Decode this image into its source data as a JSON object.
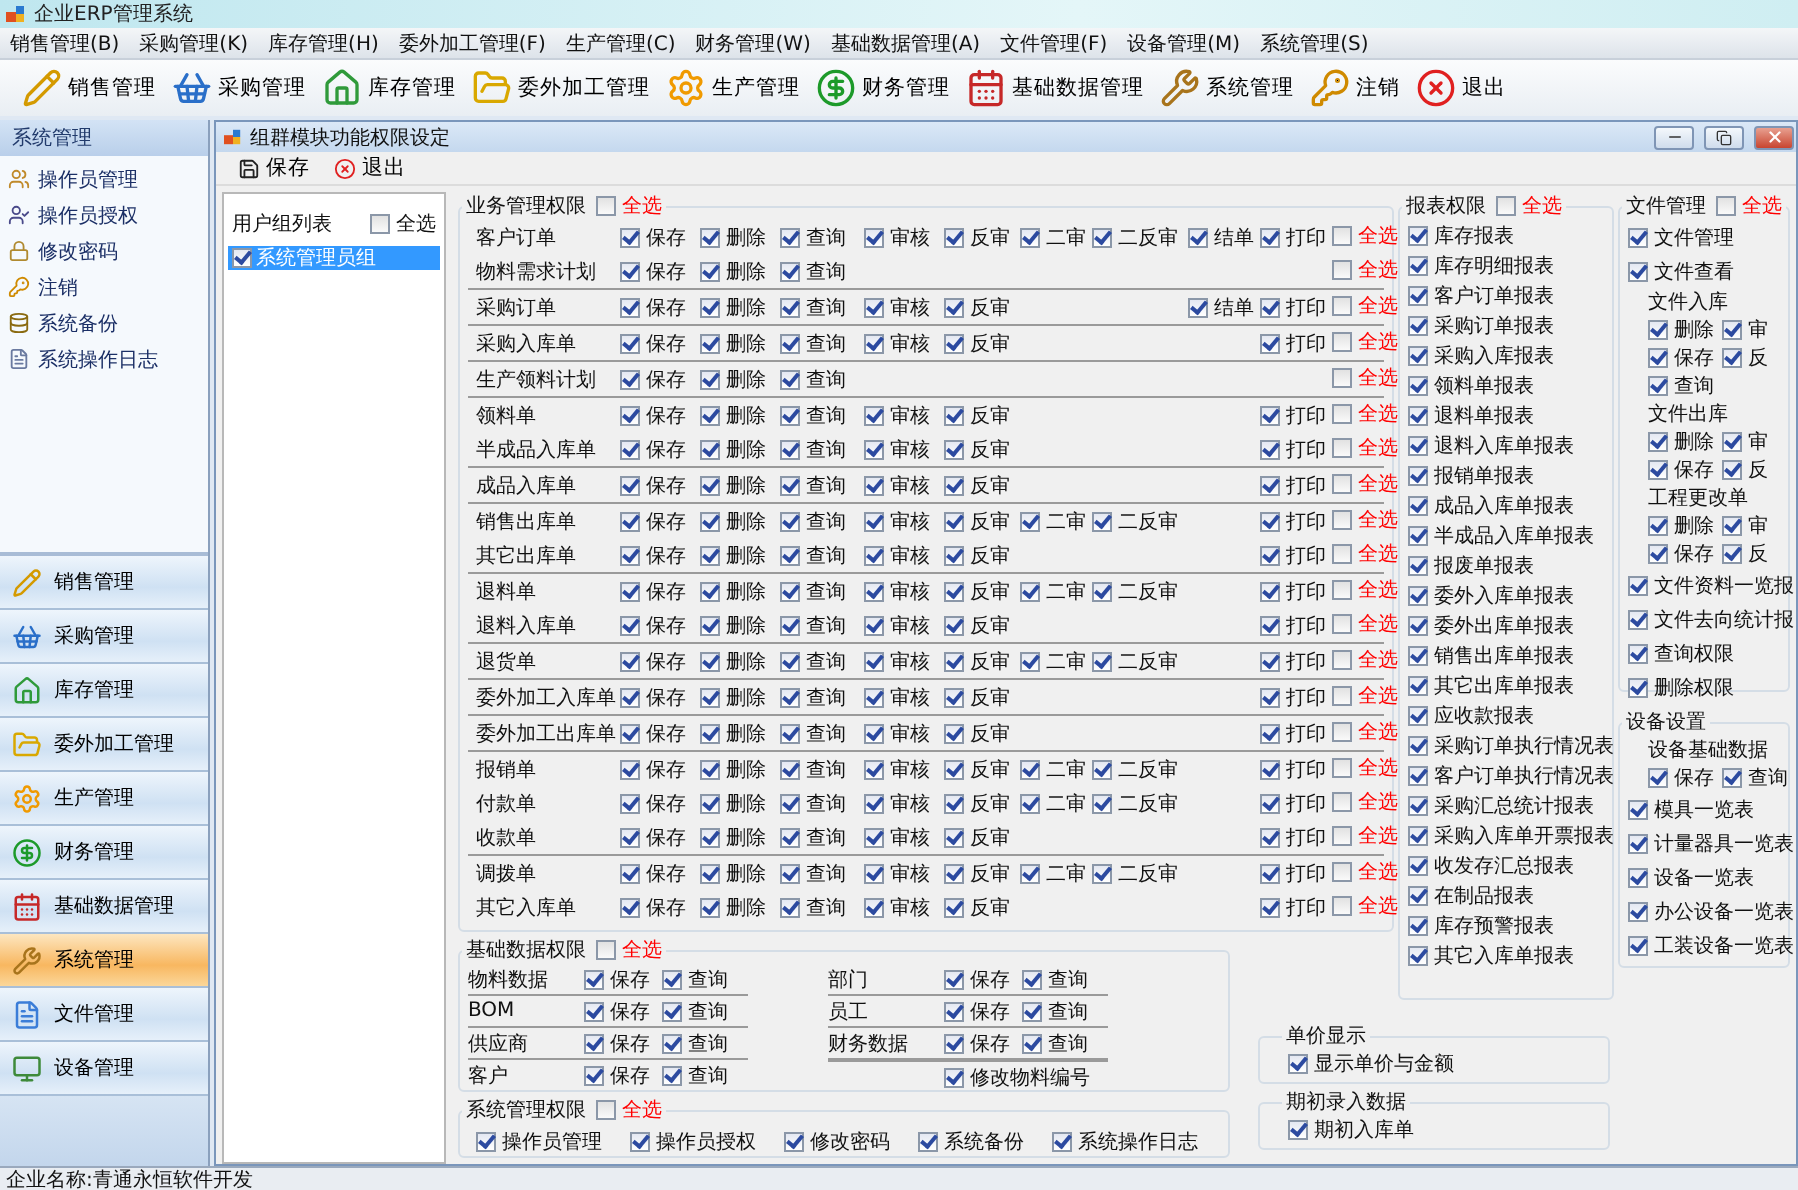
{
  "app": {
    "title": "企业ERP管理系统"
  },
  "menu": [
    "销售管理(B)",
    "采购管理(K)",
    "库存管理(H)",
    "委外加工管理(F)",
    "生产管理(C)",
    "财务管理(W)",
    "基础数据管理(A)",
    "文件管理(F)",
    "设备管理(M)",
    "系统管理(S)"
  ],
  "toolbar": [
    {
      "label": "销售管理",
      "kind": "sales"
    },
    {
      "label": "采购管理",
      "kind": "purchase"
    },
    {
      "label": "库存管理",
      "kind": "stock"
    },
    {
      "label": "委外加工管理",
      "kind": "outsourcing"
    },
    {
      "label": "生产管理",
      "kind": "production"
    },
    {
      "label": "财务管理",
      "kind": "finance"
    },
    {
      "label": "基础数据管理",
      "kind": "basedata"
    },
    {
      "label": "系统管理",
      "kind": "system"
    },
    {
      "label": "注销",
      "kind": "logout"
    },
    {
      "label": "退出",
      "kind": "exit"
    }
  ],
  "sidebar": {
    "title": "系统管理",
    "items": [
      {
        "label": "操作员管理",
        "kind": "operator"
      },
      {
        "label": "操作员授权",
        "kind": "grant"
      },
      {
        "label": "修改密码",
        "kind": "password"
      },
      {
        "label": "注销",
        "kind": "logout"
      },
      {
        "label": "系统备份",
        "kind": "backup"
      },
      {
        "label": "系统操作日志",
        "kind": "log"
      }
    ],
    "modules": [
      {
        "label": "销售管理",
        "kind": "sales",
        "selected": false
      },
      {
        "label": "采购管理",
        "kind": "purchase",
        "selected": false
      },
      {
        "label": "库存管理",
        "kind": "stock",
        "selected": false
      },
      {
        "label": "委外加工管理",
        "kind": "outsourcing",
        "selected": false
      },
      {
        "label": "生产管理",
        "kind": "production",
        "selected": false
      },
      {
        "label": "财务管理",
        "kind": "finance",
        "selected": false
      },
      {
        "label": "基础数据管理",
        "kind": "basedata",
        "selected": false
      },
      {
        "label": "系统管理",
        "kind": "system",
        "selected": true
      },
      {
        "label": "文件管理",
        "kind": "files",
        "selected": false
      },
      {
        "label": "设备管理",
        "kind": "equipment",
        "selected": false
      }
    ]
  },
  "status_bar": "企业名称:青通永恒软件开发",
  "window": {
    "title": "组群模块功能权限设定",
    "toolbar": [
      {
        "label": "保存",
        "kind": "save"
      },
      {
        "label": "退出",
        "kind": "exit"
      }
    ],
    "group_list": {
      "title": "用户组列表",
      "select_all": {
        "label": "全选",
        "checked": false
      },
      "items": [
        {
          "label": "系统管理员组",
          "checked": true,
          "selected": true
        }
      ]
    },
    "business": {
      "title": "业务管理权限",
      "select_all": {
        "label": "全选",
        "checked": false
      },
      "groups": [
        {
          "rows": [
            {
              "label": "客户订单",
              "perms": [
                {
                  "label": "保存",
                  "kind": "save",
                  "checked": true
                },
                {
                  "label": "删除",
                  "kind": "delete",
                  "checked": true
                },
                {
                  "label": "查询",
                  "kind": "query",
                  "checked": true
                },
                {
                  "label": "审核",
                  "kind": "audit",
                  "checked": true
                },
                {
                  "label": "反审",
                  "kind": "unaudit",
                  "checked": true
                },
                {
                  "label": "二审",
                  "kind": "audit2",
                  "checked": true
                },
                {
                  "label": "二反审",
                  "kind": "unaudit2",
                  "checked": true
                },
                {
                  "label": "结单",
                  "kind": "close",
                  "checked": true
                },
                {
                  "label": "打印",
                  "kind": "print",
                  "checked": true
                }
              ],
              "select_all": {
                "label": "全选",
                "checked": false
              }
            },
            {
              "label": "物料需求计划",
              "perms": [
                {
                  "label": "保存",
                  "kind": "save",
                  "checked": true
                },
                {
                  "label": "删除",
                  "kind": "delete",
                  "checked": true
                },
                {
                  "label": "查询",
                  "kind": "query",
                  "checked": true
                }
              ],
              "select_all": {
                "label": "全选",
                "checked": false
              }
            }
          ]
        },
        {
          "rows": [
            {
              "label": "采购订单",
              "perms": [
                {
                  "label": "保存",
                  "kind": "save",
                  "checked": true
                },
                {
                  "label": "删除",
                  "kind": "delete",
                  "checked": true
                },
                {
                  "label": "查询",
                  "kind": "query",
                  "checked": true
                },
                {
                  "label": "审核",
                  "kind": "audit",
                  "checked": true
                },
                {
                  "label": "反审",
                  "kind": "unaudit",
                  "checked": true
                },
                {
                  "label": "结单",
                  "kind": "close",
                  "checked": true
                },
                {
                  "label": "打印",
                  "kind": "print",
                  "checked": true
                }
              ],
              "select_all": {
                "label": "全选",
                "checked": false
              }
            }
          ]
        },
        {
          "rows": [
            {
              "label": "采购入库单",
              "perms": [
                {
                  "label": "保存",
                  "kind": "save",
                  "checked": true
                },
                {
                  "label": "删除",
                  "kind": "delete",
                  "checked": true
                },
                {
                  "label": "查询",
                  "kind": "query",
                  "checked": true
                },
                {
                  "label": "审核",
                  "kind": "audit",
                  "checked": true
                },
                {
                  "label": "反审",
                  "kind": "unaudit",
                  "checked": true
                },
                {
                  "label": "打印",
                  "kind": "print",
                  "checked": true
                }
              ],
              "select_all": {
                "label": "全选",
                "checked": false
              }
            }
          ]
        },
        {
          "rows": [
            {
              "label": "生产领料计划",
              "perms": [
                {
                  "label": "保存",
                  "kind": "save",
                  "checked": true
                },
                {
                  "label": "删除",
                  "kind": "delete",
                  "checked": true
                },
                {
                  "label": "查询",
                  "kind": "query",
                  "checked": true
                }
              ],
              "select_all": {
                "label": "全选",
                "checked": false
              }
            }
          ]
        },
        {
          "rows": [
            {
              "label": "领料单",
              "perms": [
                {
                  "label": "保存",
                  "kind": "save",
                  "checked": true
                },
                {
                  "label": "删除",
                  "kind": "delete",
                  "checked": true
                },
                {
                  "label": "查询",
                  "kind": "query",
                  "checked": true
                },
                {
                  "label": "审核",
                  "kind": "audit",
                  "checked": true
                },
                {
                  "label": "反审",
                  "kind": "unaudit",
                  "checked": true
                },
                {
                  "label": "打印",
                  "kind": "print",
                  "checked": true
                }
              ],
              "select_all": {
                "label": "全选",
                "checked": false
              }
            },
            {
              "label": "半成品入库单",
              "perms": [
                {
                  "label": "保存",
                  "kind": "save",
                  "checked": true
                },
                {
                  "label": "删除",
                  "kind": "delete",
                  "checked": true
                },
                {
                  "label": "查询",
                  "kind": "query",
                  "checked": true
                },
                {
                  "label": "审核",
                  "kind": "audit",
                  "checked": true
                },
                {
                  "label": "反审",
                  "kind": "unaudit",
                  "checked": true
                },
                {
                  "label": "打印",
                  "kind": "print",
                  "checked": true
                }
              ],
              "select_all": {
                "label": "全选",
                "checked": false
              }
            }
          ]
        },
        {
          "rows": [
            {
              "label": "成品入库单",
              "perms": [
                {
                  "label": "保存",
                  "kind": "save",
                  "checked": true
                },
                {
                  "label": "删除",
                  "kind": "delete",
                  "checked": true
                },
                {
                  "label": "查询",
                  "kind": "query",
                  "checked": true
                },
                {
                  "label": "审核",
                  "kind": "audit",
                  "checked": true
                },
                {
                  "label": "反审",
                  "kind": "unaudit",
                  "checked": true
                },
                {
                  "label": "打印",
                  "kind": "print",
                  "checked": true
                }
              ],
              "select_all": {
                "label": "全选",
                "checked": false
              }
            }
          ]
        },
        {
          "rows": [
            {
              "label": "销售出库单",
              "perms": [
                {
                  "label": "保存",
                  "kind": "save",
                  "checked": true
                },
                {
                  "label": "删除",
                  "kind": "delete",
                  "checked": true
                },
                {
                  "label": "查询",
                  "kind": "query",
                  "checked": true
                },
                {
                  "label": "审核",
                  "kind": "audit",
                  "checked": true
                },
                {
                  "label": "反审",
                  "kind": "unaudit",
                  "checked": true
                },
                {
                  "label": "二审",
                  "kind": "audit2",
                  "checked": true
                },
                {
                  "label": "二反审",
                  "kind": "unaudit2",
                  "checked": true
                },
                {
                  "label": "打印",
                  "kind": "print",
                  "checked": true
                }
              ],
              "select_all": {
                "label": "全选",
                "checked": false
              }
            },
            {
              "label": "其它出库单",
              "perms": [
                {
                  "label": "保存",
                  "kind": "save",
                  "checked": true
                },
                {
                  "label": "删除",
                  "kind": "delete",
                  "checked": true
                },
                {
                  "label": "查询",
                  "kind": "query",
                  "checked": true
                },
                {
                  "label": "审核",
                  "kind": "audit",
                  "checked": true
                },
                {
                  "label": "反审",
                  "kind": "unaudit",
                  "checked": true
                },
                {
                  "label": "打印",
                  "kind": "print",
                  "checked": true
                }
              ],
              "select_all": {
                "label": "全选",
                "checked": false
              }
            }
          ]
        },
        {
          "rows": [
            {
              "label": "退料单",
              "perms": [
                {
                  "label": "保存",
                  "kind": "save",
                  "checked": true
                },
                {
                  "label": "删除",
                  "kind": "delete",
                  "checked": true
                },
                {
                  "label": "查询",
                  "kind": "query",
                  "checked": true
                },
                {
                  "label": "审核",
                  "kind": "audit",
                  "checked": true
                },
                {
                  "label": "反审",
                  "kind": "unaudit",
                  "checked": true
                },
                {
                  "label": "二审",
                  "kind": "audit2",
                  "checked": true
                },
                {
                  "label": "二反审",
                  "kind": "unaudit2",
                  "checked": true
                },
                {
                  "label": "打印",
                  "kind": "print",
                  "checked": true
                }
              ],
              "select_all": {
                "label": "全选",
                "checked": false
              }
            },
            {
              "label": "退料入库单",
              "perms": [
                {
                  "label": "保存",
                  "kind": "save",
                  "checked": true
                },
                {
                  "label": "删除",
                  "kind": "delete",
                  "checked": true
                },
                {
                  "label": "查询",
                  "kind": "query",
                  "checked": true
                },
                {
                  "label": "审核",
                  "kind": "audit",
                  "checked": true
                },
                {
                  "label": "反审",
                  "kind": "unaudit",
                  "checked": true
                },
                {
                  "label": "打印",
                  "kind": "print",
                  "checked": true
                }
              ],
              "select_all": {
                "label": "全选",
                "checked": false
              }
            }
          ]
        },
        {
          "rows": [
            {
              "label": "退货单",
              "perms": [
                {
                  "label": "保存",
                  "kind": "save",
                  "checked": true
                },
                {
                  "label": "删除",
                  "kind": "delete",
                  "checked": true
                },
                {
                  "label": "查询",
                  "kind": "query",
                  "checked": true
                },
                {
                  "label": "审核",
                  "kind": "audit",
                  "checked": true
                },
                {
                  "label": "反审",
                  "kind": "unaudit",
                  "checked": true
                },
                {
                  "label": "二审",
                  "kind": "audit2",
                  "checked": true
                },
                {
                  "label": "二反审",
                  "kind": "unaudit2",
                  "checked": true
                },
                {
                  "label": "打印",
                  "kind": "print",
                  "checked": true
                }
              ],
              "select_all": {
                "label": "全选",
                "checked": false
              }
            }
          ]
        },
        {
          "rows": [
            {
              "label": "委外加工入库单",
              "perms": [
                {
                  "label": "保存",
                  "kind": "save",
                  "checked": true
                },
                {
                  "label": "删除",
                  "kind": "delete",
                  "checked": true
                },
                {
                  "label": "查询",
                  "kind": "query",
                  "checked": true
                },
                {
                  "label": "审核",
                  "kind": "audit",
                  "checked": true
                },
                {
                  "label": "反审",
                  "kind": "unaudit",
                  "checked": true
                },
                {
                  "label": "打印",
                  "kind": "print",
                  "checked": true
                }
              ],
              "select_all": {
                "label": "全选",
                "checked": false
              }
            }
          ]
        },
        {
          "rows": [
            {
              "label": "委外加工出库单",
              "perms": [
                {
                  "label": "保存",
                  "kind": "save",
                  "checked": true
                },
                {
                  "label": "删除",
                  "kind": "delete",
                  "checked": true
                },
                {
                  "label": "查询",
                  "kind": "query",
                  "checked": true
                },
                {
                  "label": "审核",
                  "kind": "audit",
                  "checked": true
                },
                {
                  "label": "反审",
                  "kind": "unaudit",
                  "checked": true
                },
                {
                  "label": "打印",
                  "kind": "print",
                  "checked": true
                }
              ],
              "select_all": {
                "label": "全选",
                "checked": false
              }
            }
          ]
        },
        {
          "rows": [
            {
              "label": "报销单",
              "perms": [
                {
                  "label": "保存",
                  "kind": "save",
                  "checked": true
                },
                {
                  "label": "删除",
                  "kind": "delete",
                  "checked": true
                },
                {
                  "label": "查询",
                  "kind": "query",
                  "checked": true
                },
                {
                  "label": "审核",
                  "kind": "audit",
                  "checked": true
                },
                {
                  "label": "反审",
                  "kind": "unaudit",
                  "checked": true
                },
                {
                  "label": "二审",
                  "kind": "audit2",
                  "checked": true
                },
                {
                  "label": "二反审",
                  "kind": "unaudit2",
                  "checked": true
                },
                {
                  "label": "打印",
                  "kind": "print",
                  "checked": true
                }
              ],
              "select_all": {
                "label": "全选",
                "checked": false
              }
            },
            {
              "label": "付款单",
              "perms": [
                {
                  "label": "保存",
                  "kind": "save",
                  "checked": true
                },
                {
                  "label": "删除",
                  "kind": "delete",
                  "checked": true
                },
                {
                  "label": "查询",
                  "kind": "query",
                  "checked": true
                },
                {
                  "label": "审核",
                  "kind": "audit",
                  "checked": true
                },
                {
                  "label": "反审",
                  "kind": "unaudit",
                  "checked": true
                },
                {
                  "label": "二审",
                  "kind": "audit2",
                  "checked": true
                },
                {
                  "label": "二反审",
                  "kind": "unaudit2",
                  "checked": true
                },
                {
                  "label": "打印",
                  "kind": "print",
                  "checked": true
                }
              ],
              "select_all": {
                "label": "全选",
                "checked": false
              }
            },
            {
              "label": "收款单",
              "perms": [
                {
                  "label": "保存",
                  "kind": "save",
                  "checked": true
                },
                {
                  "label": "删除",
                  "kind": "delete",
                  "checked": true
                },
                {
                  "label": "查询",
                  "kind": "query",
                  "checked": true
                },
                {
                  "label": "审核",
                  "kind": "audit",
                  "checked": true
                },
                {
                  "label": "反审",
                  "kind": "unaudit",
                  "checked": true
                },
                {
                  "label": "打印",
                  "kind": "print",
                  "checked": true
                }
              ],
              "select_all": {
                "label": "全选",
                "checked": false
              }
            }
          ]
        },
        {
          "rows": [
            {
              "label": "调拨单",
              "perms": [
                {
                  "label": "保存",
                  "kind": "save",
                  "checked": true
                },
                {
                  "label": "删除",
                  "kind": "delete",
                  "checked": true
                },
                {
                  "label": "查询",
                  "kind": "query",
                  "checked": true
                },
                {
                  "label": "审核",
                  "kind": "audit",
                  "checked": true
                },
                {
                  "label": "反审",
                  "kind": "unaudit",
                  "checked": true
                },
                {
                  "label": "二审",
                  "kind": "audit2",
                  "checked": true
                },
                {
                  "label": "二反审",
                  "kind": "unaudit2",
                  "checked": true
                },
                {
                  "label": "打印",
                  "kind": "print",
                  "checked": true
                }
              ],
              "select_all": {
                "label": "全选",
                "checked": false
              }
            },
            {
              "label": "其它入库单",
              "perms": [
                {
                  "label": "保存",
                  "kind": "save",
                  "checked": true
                },
                {
                  "label": "删除",
                  "kind": "delete",
                  "checked": true
                },
                {
                  "label": "查询",
                  "kind": "query",
                  "checked": true
                },
                {
                  "label": "审核",
                  "kind": "audit",
                  "checked": true
                },
                {
                  "label": "反审",
                  "kind": "unaudit",
                  "checked": true
                },
                {
                  "label": "打印",
                  "kind": "print",
                  "checked": true
                }
              ],
              "select_all": {
                "label": "全选",
                "checked": false
              }
            }
          ]
        }
      ]
    },
    "reports": {
      "title": "报表权限",
      "select_all": {
        "label": "全选",
        "checked": false
      },
      "items": [
        {
          "label": "库存报表",
          "checked": true
        },
        {
          "label": "库存明细报表",
          "checked": true
        },
        {
          "label": "客户订单报表",
          "checked": true
        },
        {
          "label": "采购订单报表",
          "checked": true
        },
        {
          "label": "采购入库报表",
          "checked": true
        },
        {
          "label": "领料单报表",
          "checked": true
        },
        {
          "label": "退料单报表",
          "checked": true
        },
        {
          "label": "退料入库单报表",
          "checked": true
        },
        {
          "label": "报销单报表",
          "checked": true
        },
        {
          "label": "成品入库单报表",
          "checked": true
        },
        {
          "label": "半成品入库单报表",
          "checked": true
        },
        {
          "label": "报废单报表",
          "checked": true
        },
        {
          "label": "委外入库单报表",
          "checked": true
        },
        {
          "label": "委外出库单报表",
          "checked": true
        },
        {
          "label": "销售出库单报表",
          "checked": true
        },
        {
          "label": "其它出库单报表",
          "checked": true
        },
        {
          "label": "应收款报表",
          "checked": true
        },
        {
          "label": "采购订单执行情况表",
          "checked": true
        },
        {
          "label": "客户订单执行情况表",
          "checked": true
        },
        {
          "label": "采购汇总统计报表",
          "checked": true
        },
        {
          "label": "采购入库单开票报表",
          "checked": true
        },
        {
          "label": "收发存汇总报表",
          "checked": true
        },
        {
          "label": "在制品报表",
          "checked": true
        },
        {
          "label": "库存预警报表",
          "checked": true
        },
        {
          "label": "其它入库单报表",
          "checked": true
        }
      ]
    },
    "files": {
      "title": "文件管理",
      "select_all": {
        "label": "全选",
        "checked": false
      },
      "items": [
        {
          "kind": "check",
          "label": "文件管理",
          "checked": true
        },
        {
          "kind": "check",
          "label": "文件查看",
          "checked": true
        },
        {
          "kind": "heading",
          "label": "文件入库"
        },
        {
          "kind": "pair",
          "items": [
            {
              "label": "删除",
              "checked": true
            },
            {
              "label": "审",
              "checked": true
            }
          ]
        },
        {
          "kind": "pair",
          "items": [
            {
              "label": "保存",
              "checked": true
            },
            {
              "label": "反",
              "checked": true
            }
          ]
        },
        {
          "kind": "pair",
          "items": [
            {
              "label": "查询",
              "checked": true
            }
          ]
        },
        {
          "kind": "heading",
          "label": "文件出库"
        },
        {
          "kind": "pair",
          "items": [
            {
              "label": "删除",
              "checked": true
            },
            {
              "label": "审",
              "checked": true
            }
          ]
        },
        {
          "kind": "pair",
          "items": [
            {
              "label": "保存",
              "checked": true
            },
            {
              "label": "反",
              "checked": true
            }
          ]
        },
        {
          "kind": "heading",
          "label": "工程更改单"
        },
        {
          "kind": "pair",
          "items": [
            {
              "label": "删除",
              "checked": true
            },
            {
              "label": "审",
              "checked": true
            }
          ]
        },
        {
          "kind": "pair",
          "items": [
            {
              "label": "保存",
              "checked": true
            },
            {
              "label": "反",
              "checked": true
            }
          ]
        },
        {
          "kind": "check",
          "label": "文件资料一览报",
          "checked": true
        },
        {
          "kind": "check",
          "label": "文件去向统计报",
          "checked": true
        },
        {
          "kind": "check",
          "label": "查询权限",
          "checked": true
        },
        {
          "kind": "check",
          "label": "删除权限",
          "checked": true
        }
      ]
    },
    "equipment": {
      "title": "设备设置",
      "items": [
        {
          "kind": "heading",
          "label": "设备基础数据"
        },
        {
          "kind": "pair",
          "items": [
            {
              "label": "保存",
              "checked": true
            },
            {
              "label": "查询",
              "checked": true
            }
          ]
        },
        {
          "kind": "check",
          "label": "模具一览表",
          "checked": true
        },
        {
          "kind": "check",
          "label": "计量器具一览表",
          "checked": true
        },
        {
          "kind": "check",
          "label": "设备一览表",
          "checked": true
        },
        {
          "kind": "check",
          "label": "办公设备一览表",
          "checked": true
        },
        {
          "kind": "check",
          "label": "工装设备一览表",
          "checked": true
        }
      ]
    },
    "base_data": {
      "title": "基础数据权限",
      "select_all": {
        "label": "全选",
        "checked": false
      },
      "columns": [
        [
          {
            "label": "物料数据",
            "perms": [
              {
                "label": "保存",
                "checked": true
              },
              {
                "label": "查询",
                "checked": true
              }
            ]
          },
          {
            "label": "BOM",
            "perms": [
              {
                "label": "保存",
                "checked": true
              },
              {
                "label": "查询",
                "checked": true
              }
            ]
          },
          {
            "label": "供应商",
            "perms": [
              {
                "label": "保存",
                "checked": true
              },
              {
                "label": "查询",
                "checked": true
              }
            ]
          },
          {
            "label": "客户",
            "perms": [
              {
                "label": "保存",
                "checked": true
              },
              {
                "label": "查询",
                "checked": true
              }
            ]
          }
        ],
        [
          {
            "label": "部门",
            "perms": [
              {
                "label": "保存",
                "checked": true
              },
              {
                "label": "查询",
                "checked": true
              }
            ]
          },
          {
            "label": "员工",
            "perms": [
              {
                "label": "保存",
                "checked": true
              },
              {
                "label": "查询",
                "checked": true
              }
            ]
          },
          {
            "label": "财务数据",
            "perms": [
              {
                "label": "保存",
                "checked": true
              },
              {
                "label": "查询",
                "checked": true
              }
            ]
          }
        ]
      ],
      "extra": {
        "label": "修改物料编号",
        "checked": true
      }
    },
    "system": {
      "title": "系统管理权限",
      "select_all": {
        "label": "全选",
        "checked": false
      },
      "items": [
        {
          "label": "操作员管理",
          "checked": true
        },
        {
          "label": "操作员授权",
          "checked": true
        },
        {
          "label": "修改密码",
          "checked": true
        },
        {
          "label": "系统备份",
          "checked": true
        },
        {
          "label": "系统操作日志",
          "checked": true
        }
      ]
    },
    "price": {
      "title": "单价显示",
      "items": [
        {
          "label": "显示单价与金额",
          "checked": true
        }
      ]
    },
    "opening": {
      "title": "期初录入数据",
      "items": [
        {
          "label": "期初入库单",
          "checked": true
        }
      ]
    }
  }
}
